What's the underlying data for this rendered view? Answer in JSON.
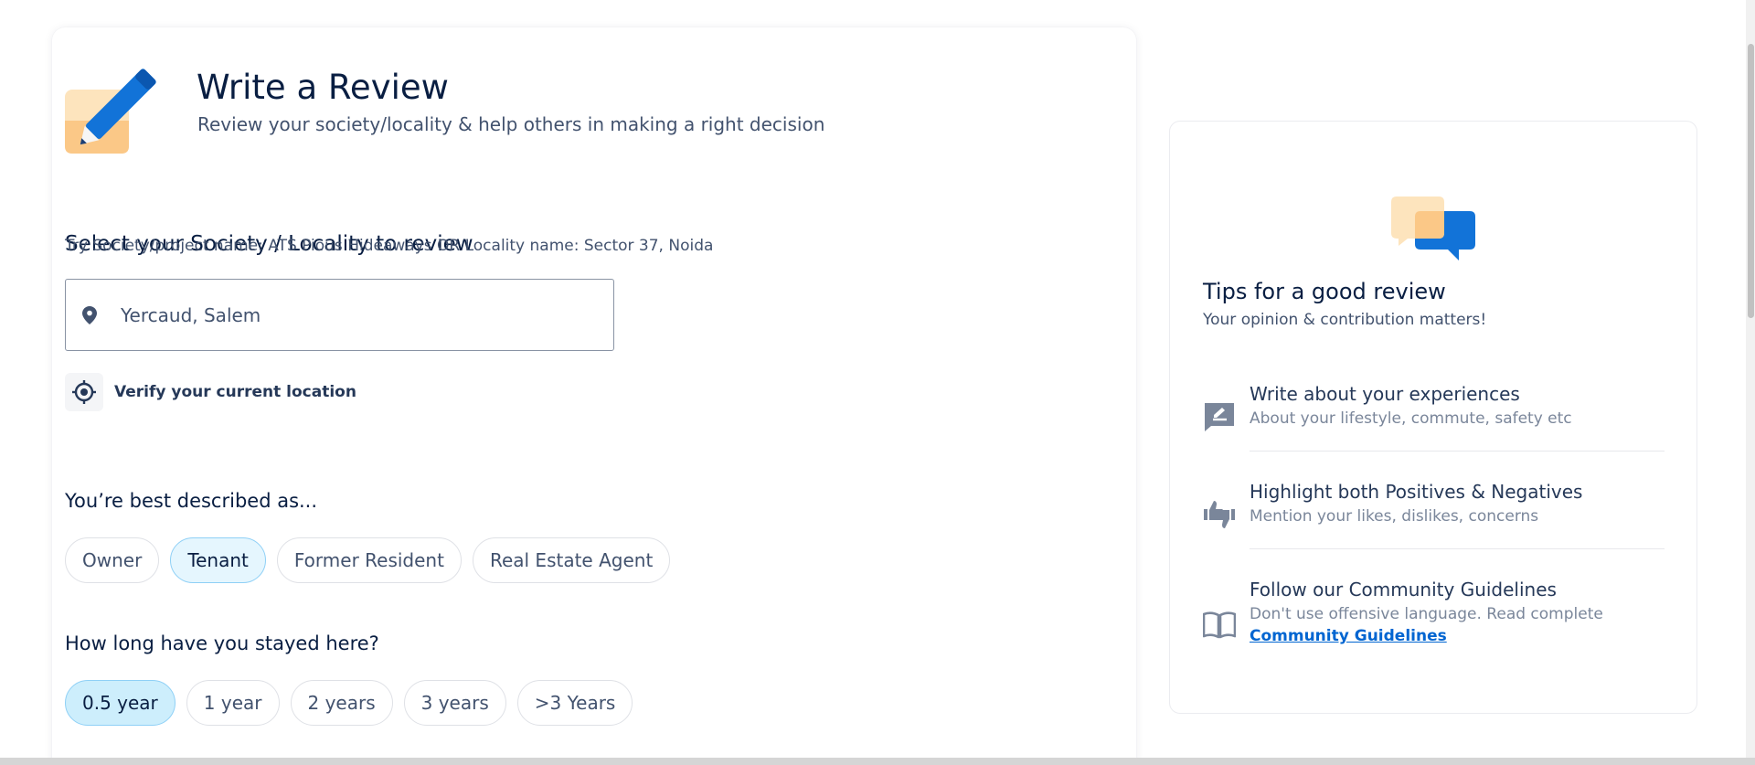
{
  "header": {
    "title": "Write a Review",
    "subtitle": "Review your society/locality & help others in making a right decision"
  },
  "society_section": {
    "heading": "Select your Society / Locality to review",
    "hint": "Try Society/project name: ATS Pious Hideaways OR Locality name: Sector 37, Noida",
    "search_value": "Yercaud, Salem",
    "verify_label": "Verify your current location"
  },
  "described_section": {
    "heading": "You’re best described as...",
    "options": [
      "Owner",
      "Tenant",
      "Former Resident",
      "Real Estate Agent"
    ],
    "selected": "Tenant"
  },
  "stay_section": {
    "heading": "How long have you stayed here?",
    "options": [
      "0.5 year",
      "1 year",
      "2 years",
      "3 years",
      ">3 Years"
    ],
    "selected": "0.5 year"
  },
  "tips": {
    "title": "Tips for a good review",
    "subtitle": "Your opinion & contribution matters!",
    "items": [
      {
        "title": "Write about your experiences",
        "desc": "About your lifestyle, commute, safety etc",
        "icon": "edit-comment-icon"
      },
      {
        "title": "Highlight both Positives & Negatives",
        "desc": "Mention your likes, dislikes, concerns",
        "icon": "thumbs-up-down-icon"
      },
      {
        "title": "Follow our Community Guidelines",
        "desc": "Don't use offensive language. Read complete",
        "link": "Community Guidelines",
        "icon": "book-icon"
      }
    ]
  },
  "colors": {
    "primary_text": "#091e42",
    "secondary_text": "#42526e",
    "link": "#0065d1",
    "chip_selected_bg": "#e5f6fe",
    "accent_blue": "#1273d8",
    "accent_peach": "#fbc887"
  }
}
